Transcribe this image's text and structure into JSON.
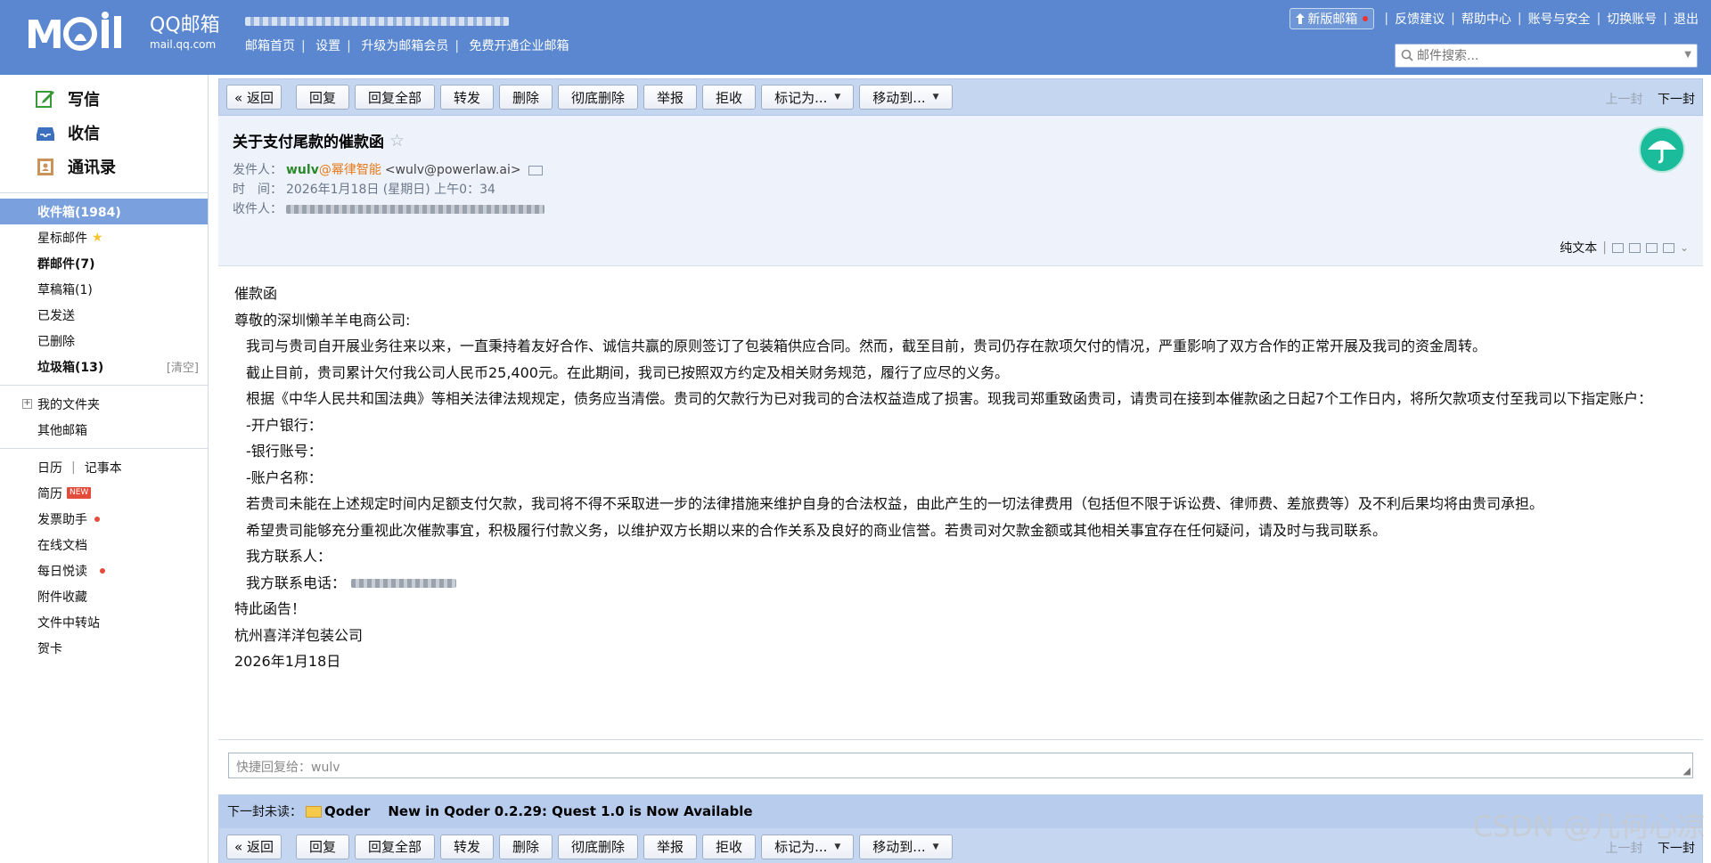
{
  "header": {
    "logo_brand": "QQ邮箱",
    "logo_url": "mail.qq.com",
    "nav": [
      "邮箱首页",
      "设置",
      "升级为邮箱会员",
      "免费开通企业邮箱"
    ],
    "links": {
      "new_version": "新版邮箱",
      "feedback": "反馈建议",
      "help": "帮助中心",
      "account_security": "账号与安全",
      "switch_account": "切换账号",
      "logout": "退出"
    },
    "search_placeholder": "邮件搜索..."
  },
  "sidebar": {
    "actions": {
      "compose": "写信",
      "receive": "收信",
      "contacts": "通讯录"
    },
    "folders": {
      "inbox": "收件箱(1984)",
      "starred": "星标邮件",
      "group": "群邮件(7)",
      "drafts": "草稿箱(1)",
      "sent": "已发送",
      "deleted": "已删除",
      "spam": "垃圾箱(13)",
      "spam_clear": "[清空]",
      "my_folders": "我的文件夹",
      "other_mail": "其他邮箱"
    },
    "tools": {
      "calendar": "日历",
      "notebook": "记事本",
      "resume": "简历",
      "new_badge": "NEW",
      "invoice": "发票助手",
      "online_docs": "在线文档",
      "daily_reading": "每日悦读",
      "attachments": "附件收藏",
      "file_transfer": "文件中转站",
      "greeting_card": "贺卡"
    }
  },
  "toolbar": {
    "back": "« 返回",
    "reply": "回复",
    "reply_all": "回复全部",
    "forward": "转发",
    "delete": "删除",
    "delete_permanent": "彻底删除",
    "report": "举报",
    "reject": "拒收",
    "mark_as": "标记为...",
    "move_to": "移动到...",
    "prev": "上一封",
    "next": "下一封"
  },
  "mail": {
    "subject": "关于支付尾款的催款函",
    "from_label": "发件人：",
    "sender_name": "wulv",
    "sender_org": "@幂律智能",
    "sender_addr": "<wulv@powerlaw.ai>",
    "time_label": "时　间：",
    "time": "2026年1月18日 (星期日) 上午0：34",
    "to_label": "收件人：",
    "plain_text": "纯文本",
    "body": [
      "催款函",
      "尊敬的深圳懒羊羊电商公司:",
      "我司与贵司自开展业务往来以来，一直秉持着友好合作、诚信共赢的原则签订了包装箱供应合同。然而，截至目前，贵司仍存在款项欠付的情况，严重影响了双方合作的正常开展及我司的资金周转。",
      "截止目前，贵司累计欠付我公司人民币25,400元。在此期间，我司已按照双方约定及相关财务规范，履行了应尽的义务。",
      "根据《中华人民共和国法典》等相关法律法规规定，债务应当清偿。贵司的欠款行为已对我司的合法权益造成了损害。现我司郑重致函贵司，请贵司在接到本催款函之日起7个工作日内，将所欠款项支付至我司以下指定账户：",
      "-开户银行：",
      "-银行账号：",
      "-账户名称：",
      "若贵司未能在上述规定时间内足额支付欠款，我司将不得不采取进一步的法律措施来维护自身的合法权益，由此产生的一切法律费用（包括但不限于诉讼费、律师费、差旅费等）及不利后果均将由贵司承担。",
      "希望贵司能够充分重视此次催款事宜，积极履行付款义务，以维护双方长期以来的合作关系及良好的商业信誉。若贵司对欠款金额或其他相关事宜存在任何疑问，请及时与我司联系。",
      "我方联系人：",
      "我方联系电话：",
      "特此函告！",
      "杭州喜洋洋包装公司",
      "2026年1月18日"
    ]
  },
  "quick_reply": {
    "placeholder": "快捷回复给：wulv"
  },
  "next_unread": {
    "label": "下一封未读：",
    "from": "Qoder",
    "subject": "New in Qoder 0.2.29: Quest 1.0 is Now Available"
  },
  "watermark": "CSDN @几何心凉",
  "colors": {
    "header_bg": "#5a87cf",
    "toolbar_bg": "#c5d6f0",
    "sidebar_active": "#7aa1dd",
    "sender_green": "#2a8a2a",
    "org_orange": "#e57a1a"
  }
}
